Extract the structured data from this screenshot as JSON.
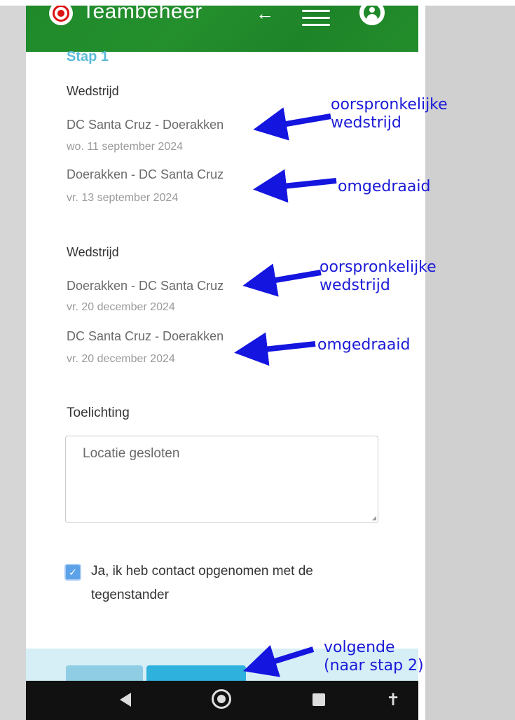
{
  "app": {
    "brand": "Teambeheer"
  },
  "form": {
    "step": "Stap 1",
    "matches": [
      {
        "section_title": "Wedstrijd",
        "original": {
          "teams": "DC Santa Cruz - Doerakken",
          "date": "wo. 11 september 2024"
        },
        "reversed": {
          "teams": "Doerakken - DC Santa Cruz",
          "date": "vr. 13 september 2024"
        }
      },
      {
        "section_title": "Wedstrijd",
        "original": {
          "teams": "Doerakken - DC Santa Cruz",
          "date": "vr. 20 december 2024"
        },
        "reversed": {
          "teams": "DC Santa Cruz - Doerakken",
          "date": "vr. 20 december 2024"
        }
      }
    ],
    "explanation_label": "Toelichting",
    "explanation_value": "Locatie gesloten",
    "contact_checkbox": {
      "checked": true,
      "label": "Ja, ik heb contact opgenomen met de tegenstander"
    }
  },
  "annotations": {
    "a1": "oorspronkelijke\nwedstrijd",
    "a2": "omgedraaid",
    "a3": "oorspronkelijke\nwedstrijd",
    "a4": "omgedraaid",
    "a5": "volgende\n(naar stap 2)"
  },
  "colors": {
    "header_green": "#1f8a2a",
    "step_blue": "#5bbbd8",
    "annotation_blue": "#1a1ad8",
    "primary_button": "#2eb1dc"
  }
}
